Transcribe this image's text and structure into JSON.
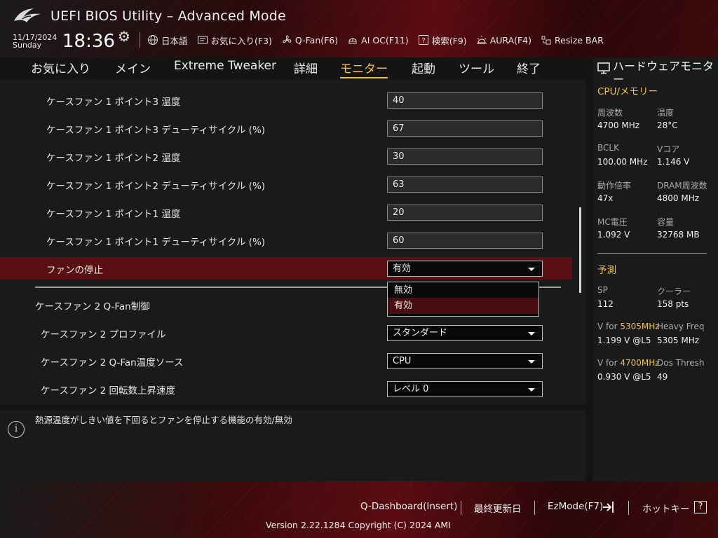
{
  "header": {
    "title": "UEFI BIOS Utility – Advanced Mode",
    "date": "11/17/2024",
    "day": "Sunday",
    "time": "18:36",
    "toolbar": [
      {
        "icon": "globe-icon",
        "label": "日本語"
      },
      {
        "icon": "favorites-icon",
        "label": "お気に入り(F3)"
      },
      {
        "icon": "fan-icon",
        "label": "Q-Fan(F6)"
      },
      {
        "icon": "ai-oc-icon",
        "label": "AI OC(F11)"
      },
      {
        "icon": "help-search-icon",
        "label": "検索(F9)"
      },
      {
        "icon": "aura-icon",
        "label": "AURA(F4)"
      },
      {
        "icon": "resize-bar-icon",
        "label": "Resize BAR"
      }
    ]
  },
  "nav": {
    "tabs": [
      "お気に入り",
      "メイン",
      "Extreme Tweaker",
      "詳細",
      "モニター",
      "起動",
      "ツール",
      "終了"
    ],
    "active": "モニター"
  },
  "settings": [
    {
      "label": "ケースファン 1 ポイント3 温度",
      "value": "40"
    },
    {
      "label": "ケースファン 1 ポイント3 デューティサイクル (%)",
      "value": "67"
    },
    {
      "label": "ケースファン 1 ポイント2 温度",
      "value": "30"
    },
    {
      "label": "ケースファン 1 ポイント2 デューティサイクル (%)",
      "value": "63"
    },
    {
      "label": "ケースファン 1 ポイント1 温度",
      "value": "20"
    },
    {
      "label": "ケースファン 1 ポイント1 デューティサイクル (%)",
      "value": "60"
    },
    {
      "label": "ファンの停止",
      "value": "有効"
    },
    {
      "label": "ケースファン 2 Q-Fan制御"
    },
    {
      "label": "ケースファン 2 プロファイル",
      "value": "スタンダード"
    },
    {
      "label": "ケースファン 2 Q-Fan温度ソース",
      "value": "CPU"
    },
    {
      "label": "ケースファン 2 回転数上昇速度",
      "value": "レベル 0"
    }
  ],
  "dropdown": {
    "options": [
      "無効",
      "有効"
    ],
    "selected": "有効"
  },
  "help": {
    "text": "熱源温度がしきい値を下回るとファンを停止する機能の有効/無効"
  },
  "monitor": {
    "title": "ハードウェアモニター",
    "cpu_section": "CPU/メモリー",
    "cpu_items": [
      {
        "label": "周波数",
        "value": "4700 MHz"
      },
      {
        "label": "温度",
        "value": "28°C"
      },
      {
        "label": "BCLK",
        "value": "100.00 MHz"
      },
      {
        "label": "Vコア",
        "value": "1.146 V"
      },
      {
        "label": "動作倍率",
        "value": "47x"
      },
      {
        "label": "DRAM周波数",
        "value": "4800 MHz"
      },
      {
        "label": "MC電圧",
        "value": "1.092 V"
      },
      {
        "label": "容量",
        "value": "32768 MB"
      }
    ],
    "prediction_section": "予測",
    "prediction_items": [
      {
        "label": "SP",
        "value": "112"
      },
      {
        "label": "クーラー",
        "value": "158 pts"
      },
      {
        "label_prefix": "V for ",
        "label_highlight": "5305MHz",
        "value": "1.199 V @L5"
      },
      {
        "label": "Heavy Freq",
        "value": "5305 MHz"
      },
      {
        "label_prefix": "V for ",
        "label_highlight": "4700MHz",
        "value": "0.930 V @L5"
      },
      {
        "label": "Dos Thresh",
        "value": "49"
      }
    ]
  },
  "footer": {
    "qdashboard": "Q-Dashboard(Insert)",
    "last_modified": "最終更新日",
    "ezmode": "EzMode(F7)",
    "hotkeys": "ホットキー",
    "hotkey_symbol": "?",
    "version": "Version 2.22.1284 Copyright (C) 2024 AMI"
  },
  "colors": {
    "accent": "#f1c232",
    "highlight_row": "#5a1012",
    "background": "#1a1a1a"
  }
}
